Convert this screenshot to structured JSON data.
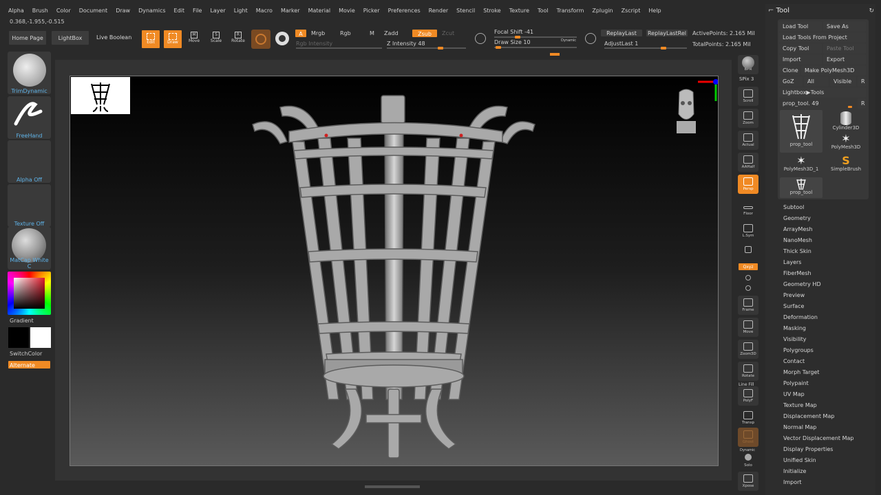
{
  "menubar": [
    "Alpha",
    "Brush",
    "Color",
    "Document",
    "Draw",
    "Dynamics",
    "Edit",
    "File",
    "Layer",
    "Light",
    "Macro",
    "Marker",
    "Material",
    "Movie",
    "Picker",
    "Preferences",
    "Render",
    "Stencil",
    "Stroke",
    "Texture",
    "Tool",
    "Transform",
    "Zplugin",
    "Zscript",
    "Help"
  ],
  "coords": "0.368,-1.955,-0.515",
  "top_buttons": {
    "home": "Home Page",
    "lightbox": "LightBox",
    "live_boolean": "Live Boolean"
  },
  "modes": {
    "edit": "Edit",
    "draw": "Draw",
    "move": "Move",
    "scale": "Scale",
    "rotate": "Rotate"
  },
  "color_mode": {
    "a": "A",
    "mrgb": "Mrgb",
    "rgb": "Rgb",
    "m": "M",
    "zadd": "Zadd",
    "zsub": "Zsub",
    "zcut": "Zcut",
    "rgb_intensity": "Rgb Intensity",
    "z_intensity": "Z Intensity 48"
  },
  "brush": {
    "focal_shift": "Focal Shift -41",
    "draw_size": "Draw Size 10",
    "dynamic": "Dynamic"
  },
  "replay": {
    "replay_last": "ReplayLast",
    "replay_last_rel": "ReplayLastRel",
    "adjust_last": "AdjustLast 1"
  },
  "points": {
    "active": "ActivePoints: 2.165 Mil",
    "total": "TotalPoints: 2.165 Mil"
  },
  "left_tiles": {
    "brush": "TrimDynamic",
    "stroke": "FreeHand",
    "alpha": "Alpha Off",
    "texture": "Texture Off",
    "material": "MatCap White C"
  },
  "gradient": "Gradient",
  "switch_color": "SwitchColor",
  "alternate": "Alternate",
  "right_shelf": {
    "bpr": "BPR",
    "spix": "SPix 3",
    "scroll": "Scroll",
    "zoom": "Zoom",
    "actual": "Actual",
    "aahalf": "AAHalf",
    "persp": "Persp",
    "floor": "Floor",
    "lsym": "L.Sym",
    "xyz": "Qxyz",
    "frame": "Frame",
    "move": "Move",
    "zoom3d": "Zoom3D",
    "rotate": "Rotate",
    "polyf": "PolyF",
    "line_fill": "Line Fill",
    "transp": "Transp",
    "ghost": "Ghost",
    "dynamic": "Dynamic",
    "solo": "Solo",
    "xpose": "Xpose"
  },
  "tool_panel": {
    "title": "Tool",
    "load_tool": "Load Tool",
    "save_as": "Save As",
    "load_from_project": "Load Tools From Project",
    "copy_tool": "Copy Tool",
    "paste_tool": "Paste Tool",
    "import": "Import",
    "export": "Export",
    "clone": "Clone",
    "make_polymesh": "Make PolyMesh3D",
    "goz": "GoZ",
    "all": "All",
    "visible": "Visible",
    "r": "R",
    "lightbox_tools": "Lightbox▶Tools",
    "current_tool": "prop_tool. 49",
    "thumbs": [
      "prop_tool",
      "Cylinder3D",
      "PolyMesh3D",
      "PolyMesh3D_1",
      "SimpleBrush",
      "prop_tool"
    ],
    "subpalettes": [
      "Subtool",
      "Geometry",
      "ArrayMesh",
      "NanoMesh",
      "Thick Skin",
      "Layers",
      "FiberMesh",
      "Geometry HD",
      "Preview",
      "Surface",
      "Deformation",
      "Masking",
      "Visibility",
      "Polygroups",
      "Contact",
      "Morph Target",
      "Polypaint",
      "UV Map",
      "Texture Map",
      "Displacement Map",
      "Normal Map",
      "Vector Displacement Map",
      "Display Properties",
      "Unified Skin",
      "Initialize",
      "Import"
    ]
  },
  "colors": {
    "accent": "#f08a24",
    "bg": "#2a2a2a",
    "panel": "#3a3a3a"
  }
}
